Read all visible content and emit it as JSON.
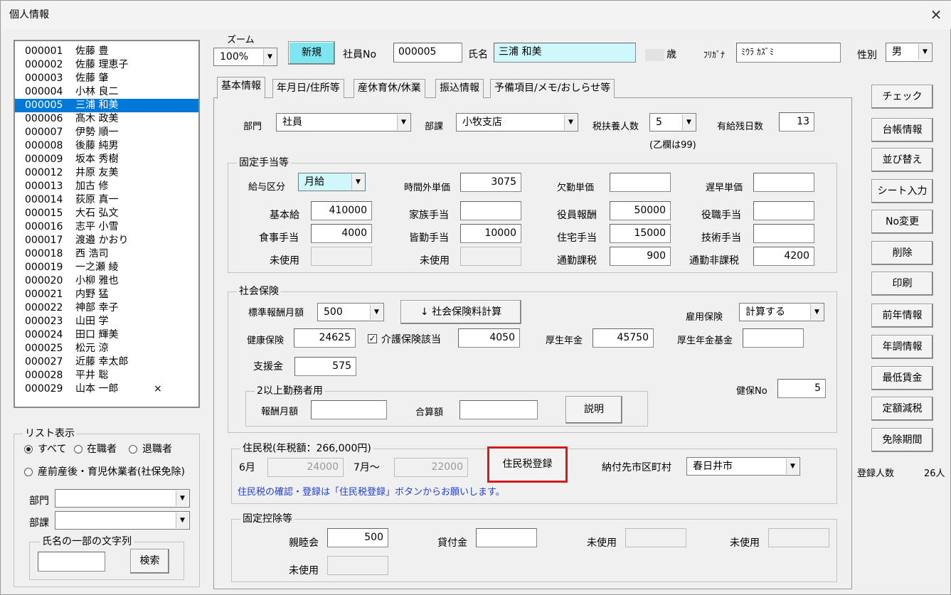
{
  "window": {
    "title": "個人情報",
    "close_label": "×"
  },
  "employees": [
    {
      "no": "000001",
      "name": "佐藤 豊",
      "mark": ""
    },
    {
      "no": "000002",
      "name": "佐藤 理恵子",
      "mark": ""
    },
    {
      "no": "000003",
      "name": "佐藤 肇",
      "mark": ""
    },
    {
      "no": "000004",
      "name": "小林 良二",
      "mark": ""
    },
    {
      "no": "000005",
      "name": "三浦 和美",
      "mark": ""
    },
    {
      "no": "000006",
      "name": "髙木 政美",
      "mark": ""
    },
    {
      "no": "000007",
      "name": "伊勢 順一",
      "mark": ""
    },
    {
      "no": "000008",
      "name": "後藤 純男",
      "mark": ""
    },
    {
      "no": "000009",
      "name": "坂本 秀樹",
      "mark": ""
    },
    {
      "no": "000012",
      "name": "井原 友美",
      "mark": ""
    },
    {
      "no": "000013",
      "name": "加古 修",
      "mark": ""
    },
    {
      "no": "000014",
      "name": "荻原 真一",
      "mark": ""
    },
    {
      "no": "000015",
      "name": "大石 弘文",
      "mark": ""
    },
    {
      "no": "000016",
      "name": "志平 小雪",
      "mark": ""
    },
    {
      "no": "000017",
      "name": "渡邉 かおり",
      "mark": ""
    },
    {
      "no": "000018",
      "name": "西 浩司",
      "mark": ""
    },
    {
      "no": "000019",
      "name": "一之瀬 綾",
      "mark": ""
    },
    {
      "no": "000020",
      "name": "小柳 雅也",
      "mark": ""
    },
    {
      "no": "000021",
      "name": "内野 猛",
      "mark": ""
    },
    {
      "no": "000022",
      "name": "神部 幸子",
      "mark": ""
    },
    {
      "no": "000023",
      "name": "山田 学",
      "mark": ""
    },
    {
      "no": "000024",
      "name": "田口 輝美",
      "mark": ""
    },
    {
      "no": "000025",
      "name": "松元 涼",
      "mark": ""
    },
    {
      "no": "000027",
      "name": "近藤 幸太郎",
      "mark": ""
    },
    {
      "no": "000028",
      "name": "平井 聡",
      "mark": ""
    },
    {
      "no": "000029",
      "name": "山本 一郎",
      "mark": "×"
    }
  ],
  "selected_index": 4,
  "list_display": {
    "caption": "リスト表示",
    "all": "すべて",
    "active": "在職者",
    "retired": "退職者",
    "leave": "産前産後・育児休業者(社保免除)",
    "selected": "all",
    "dept_label": "部門",
    "section_label": "部課",
    "partial_caption": "氏名の一部の文字列",
    "search_button": "検索"
  },
  "header": {
    "zoom_label": "ズーム",
    "zoom_value": "100%",
    "new_button": "新規",
    "emp_no_label": "社員No",
    "emp_no": "000005",
    "name_label": "氏名",
    "name": "三浦 和美",
    "age_unit": "歳",
    "kana_label": "ﾌﾘｶﾞﾅ",
    "kana": "ﾐｳﾗ ｶｽﾞﾐ",
    "gender_label": "性別",
    "gender": "男"
  },
  "tabs": [
    "基本情報",
    "年月日/住所等",
    "産休育休/休業",
    "振込情報",
    "予備項目/メモ/おしらせ等"
  ],
  "basic": {
    "dept_label": "部門",
    "dept": "社員",
    "section_label": "部課",
    "section": "小牧支店",
    "dependents_label": "税扶養人数",
    "dependents": "5",
    "dependents_note": "(乙欄は99)",
    "paid_leave_label": "有給残日数",
    "paid_leave": "13"
  },
  "allowances": {
    "caption": "固定手当等",
    "pay_type_label": "給与区分",
    "pay_type": "月給",
    "overtime_label": "時間外単価",
    "overtime": "3075",
    "absence_label": "欠勤単価",
    "absence": "",
    "late_label": "遅早単価",
    "late": "",
    "base_label": "基本給",
    "base": "410000",
    "family_label": "家族手当",
    "family": "",
    "officer_label": "役員報酬",
    "officer": "50000",
    "position_label": "役職手当",
    "position": "",
    "meal_label": "食事手当",
    "meal": "4000",
    "attendance_label": "皆勤手当",
    "attendance": "10000",
    "housing_label": "住宅手当",
    "housing": "15000",
    "skill_label": "技術手当",
    "skill": "",
    "unused1_label": "未使用",
    "unused1": "",
    "unused2_label": "未使用",
    "unused2": "",
    "commute_tax_label": "通勤課税",
    "commute_tax": "900",
    "commute_notax_label": "通勤非課税",
    "commute_notax": "4200"
  },
  "insurance": {
    "caption": "社会保険",
    "std_label": "標準報酬月額",
    "std": "500",
    "calc_button": "↓  社会保険料計算",
    "employment_label": "雇用保険",
    "employment": "計算する",
    "health_label": "健康保険",
    "health": "24625",
    "care_label": "介護保険該当",
    "care_checked": true,
    "care": "4050",
    "pension_label": "厚生年金",
    "pension": "45750",
    "fund_label": "厚生年金基金",
    "fund": "",
    "support_label": "支援金",
    "support": "575",
    "health_no_label": "健保No",
    "health_no": "5",
    "multi_caption": "2以上勤務者用",
    "multi_pay_label": "報酬月額",
    "multi_pay": "",
    "multi_total_label": "合算額",
    "multi_total": "",
    "explain_button": "説明"
  },
  "resident": {
    "caption": "住民税(年税額：266,000円)",
    "june_label": "6月",
    "june": "24000",
    "july_label": "7月～",
    "july": "22000",
    "register_button": "住民税登録",
    "city_label": "納付先市区町村",
    "city": "春日井市",
    "note": "住民税の確認・登録は「住民税登録」ボタンからお願いします。"
  },
  "deductions": {
    "caption": "固定控除等",
    "social_label": "親睦会",
    "social": "500",
    "loan_label": "貸付金",
    "loan": "",
    "unused1_label": "未使用",
    "unused1": "",
    "unused2_label": "未使用",
    "unused2": "",
    "unused3_label": "未使用",
    "unused3": ""
  },
  "side_buttons": [
    "チェック",
    "台帳情報",
    "並び替え",
    "シート入力",
    "No変更",
    "削除",
    "印刷",
    "前年情報",
    "年調情報",
    "最低賃金",
    "定額減税",
    "免除期間"
  ],
  "footer": {
    "count_label": "登録人数",
    "count": "26人"
  },
  "colors": {
    "highlight_field": "#cff8fc",
    "selection": "#0078d7",
    "new_button": "#7ee6ee",
    "register_border": "#d61a1a",
    "note_text": "#1f3ecf"
  }
}
